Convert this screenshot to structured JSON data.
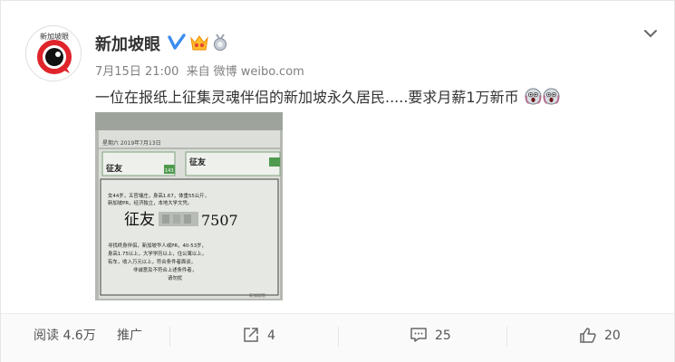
{
  "post": {
    "author": "新加坡眼",
    "avatar_text": "新加坡眼",
    "date": "7月15日 21:00",
    "from_label": "来自",
    "source": "微博 weibo.com",
    "text": "一位在报纸上征集灵魂伴侣的新加坡永久居民.....要求月薪1万新币"
  },
  "newspaper": {
    "date": "星期六  2019年7月13日",
    "header1": "征友",
    "header2": "征友",
    "box_num": "143",
    "line1": "女44岁，五官端庄，身高1.67，体重55公斤，",
    "line2": "新加坡PR，经济独立，本地大学文凭。",
    "big_label": "征友",
    "big_number": "7507",
    "line3": "寻找终身伴侣，新加坡华人或PR，40-53岁，",
    "line4": "身高1.75以上，大学学历以上，住公寓以上，",
    "line5": "有车，收入万元以上，符合条件者面谈，",
    "line6": "非诚意及不符合上述条件者，",
    "line7": "请勿扰",
    "watermark": "新加坡眼"
  },
  "actions": {
    "read_label": "阅读 4.6万",
    "promote_label": "推广",
    "forward_count": "4",
    "comment_count": "25",
    "like_count": "20"
  },
  "colors": {
    "weibo_orange": "#ff8200",
    "verified_blue": "#3b8df0"
  }
}
